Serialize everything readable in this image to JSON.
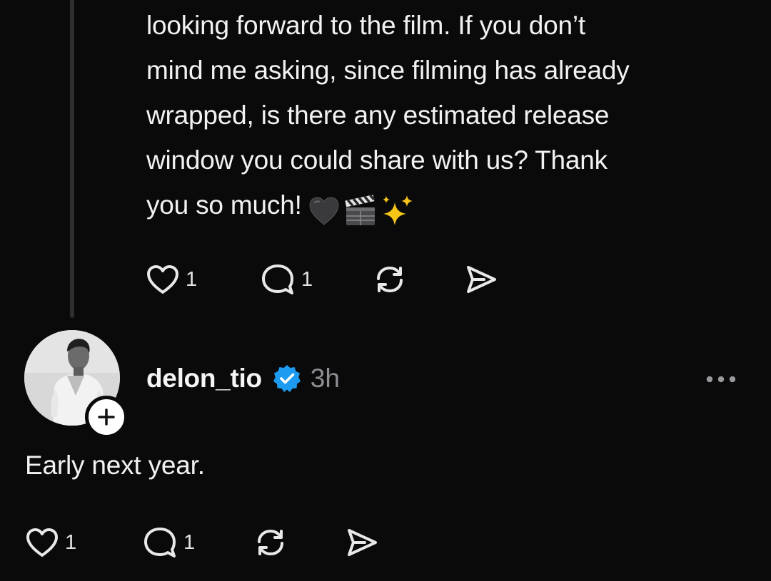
{
  "parent_post": {
    "text": "looking forward to the film. If you don’t\nmind me asking, since filming has already\nwrapped, is there any estimated release\nwindow you could share with us? Thank\nyou so much!",
    "emojis": [
      "black-heart",
      "clapper-board",
      "sparkles"
    ],
    "actions": {
      "like_count": "1",
      "reply_count": "1"
    }
  },
  "reply_post": {
    "username": "delon_tio",
    "verified": true,
    "timestamp": "3h",
    "text": "Early next year.",
    "actions": {
      "like_count": "1",
      "reply_count": "1"
    }
  },
  "colors": {
    "background": "#0a0a0b",
    "text": "#f2f2f2",
    "muted": "#8e8e93",
    "verified_blue": "#1d9bf0",
    "thread_line": "#2e2e30"
  },
  "icons": {
    "like": "heart-outline-icon",
    "reply": "speech-bubble-icon",
    "repost": "repost-arrows-icon",
    "share": "paper-plane-icon",
    "more": "ellipsis-icon",
    "follow": "plus-icon",
    "verified": "verified-badge-icon"
  }
}
